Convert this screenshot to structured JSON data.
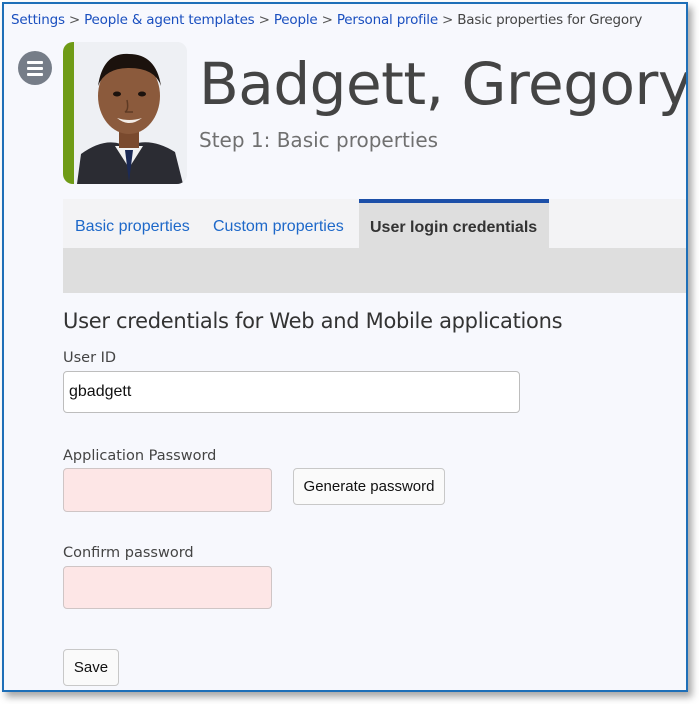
{
  "breadcrumb": {
    "items": [
      "Settings",
      "People & agent templates",
      "People",
      "Personal profile"
    ],
    "current": "Basic properties for Gregory",
    "separator": ">"
  },
  "menu": {
    "icon": "hamburger-menu-icon"
  },
  "profile": {
    "name": "Badgett, Gregory",
    "step": "Step 1: Basic properties",
    "accent_color": "#6f9b16"
  },
  "tabs": [
    {
      "label": "Basic properties",
      "active": false
    },
    {
      "label": "Custom properties",
      "active": false
    },
    {
      "label": "User login credentials",
      "active": true
    }
  ],
  "section": {
    "title": "User credentials for Web and Mobile applications"
  },
  "form": {
    "user_id_label": "User ID",
    "user_id_value": "gbadgett",
    "app_password_label": "Application Password",
    "app_password_value": "",
    "generate_label": "Generate password",
    "confirm_label": "Confirm password",
    "confirm_value": "",
    "save_label": "Save"
  },
  "colors": {
    "link": "#1a4fbf",
    "active_tab_border": "#1c4fa8",
    "required_field_bg": "#fde6e6",
    "frame_border": "#1e6fb8"
  }
}
